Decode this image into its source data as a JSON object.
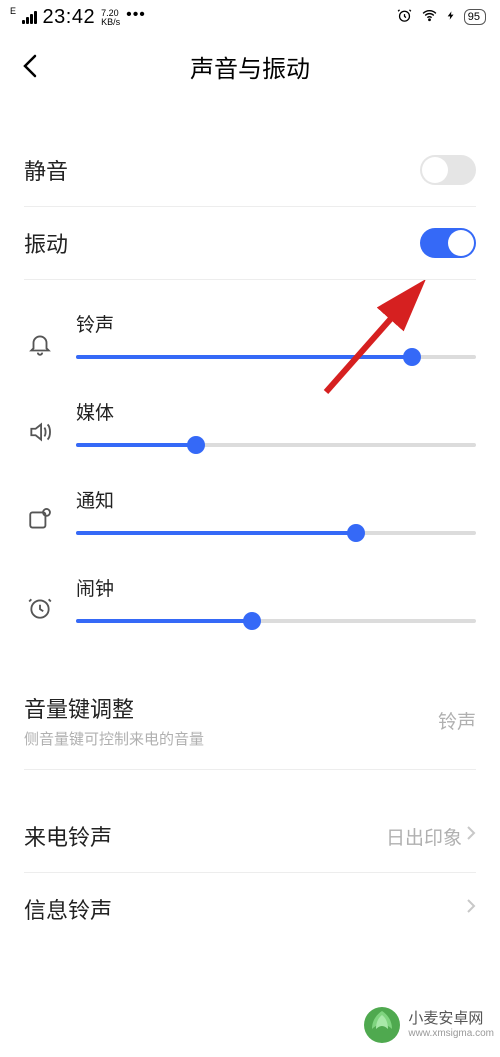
{
  "status": {
    "signal_type": "E",
    "time": "23:42",
    "speed_top": "7.20",
    "speed_bot": "KB/s",
    "battery": "95"
  },
  "header": {
    "title": "声音与振动"
  },
  "toggles": {
    "silent": {
      "label": "静音",
      "on": false
    },
    "vibrate": {
      "label": "振动",
      "on": true
    }
  },
  "sliders": {
    "ringtone": {
      "label": "铃声",
      "percent": 84
    },
    "media": {
      "label": "媒体",
      "percent": 30
    },
    "notification": {
      "label": "通知",
      "percent": 70
    },
    "alarm": {
      "label": "闹钟",
      "percent": 44
    }
  },
  "volume_adjust": {
    "label": "音量键调整",
    "sub": "侧音量键可控制来电的音量",
    "value": "铃声"
  },
  "incoming_ringtone": {
    "label": "来电铃声",
    "value": "日出印象"
  },
  "msg_ringtone": {
    "label": "信息铃声"
  },
  "watermark": {
    "title": "小麦安卓网",
    "url": "www.xmsigma.com"
  }
}
